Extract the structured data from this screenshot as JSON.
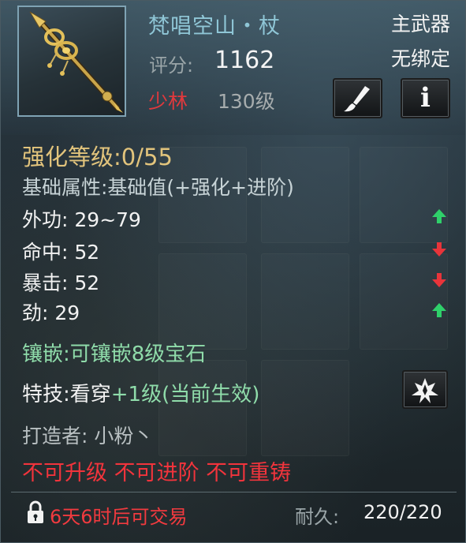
{
  "item": {
    "name": "梵唱空山・杖",
    "score_label": "评分:",
    "score_value": "1162",
    "school": "少林",
    "level": "130级",
    "slot": "主武器",
    "bind_status": "无绑定",
    "weapon_icon": "staff-icon"
  },
  "actions": {
    "brush_icon": "brush-icon",
    "info_icon": "info-icon",
    "info_glyph": "i",
    "skill_icon": "skill-burst-icon"
  },
  "enhance": {
    "label": "强化等级:",
    "value": "0/55"
  },
  "base_attr_text": "基础属性:基础值(+强化+进阶)",
  "stats": [
    {
      "label": "外功:",
      "value": "29~79",
      "trend": "up"
    },
    {
      "label": "命中:",
      "value": "52",
      "trend": "down"
    },
    {
      "label": "暴击:",
      "value": "52",
      "trend": "down"
    },
    {
      "label": "劲:",
      "value": "29",
      "trend": "up"
    }
  ],
  "socket": "镶嵌:可镶嵌8级宝石",
  "skill": {
    "prefix": "特技:看穿",
    "suffix": "+1级(当前生效)"
  },
  "maker": "打造者: 小粉丶",
  "restrictions": "不可升级 不可进阶 不可重铸",
  "footer": {
    "lock_icon": "lock-icon",
    "trade": "6天6时后可交易",
    "durability_label": "耐久:",
    "durability_value": "220/220"
  },
  "colors": {
    "title": "#8fc6d6",
    "enhance": "#e2c47c",
    "socket": "#8fdcaa",
    "warning": "#f2343c",
    "arrow_up": "#2fd06a",
    "arrow_down": "#e8343a"
  }
}
